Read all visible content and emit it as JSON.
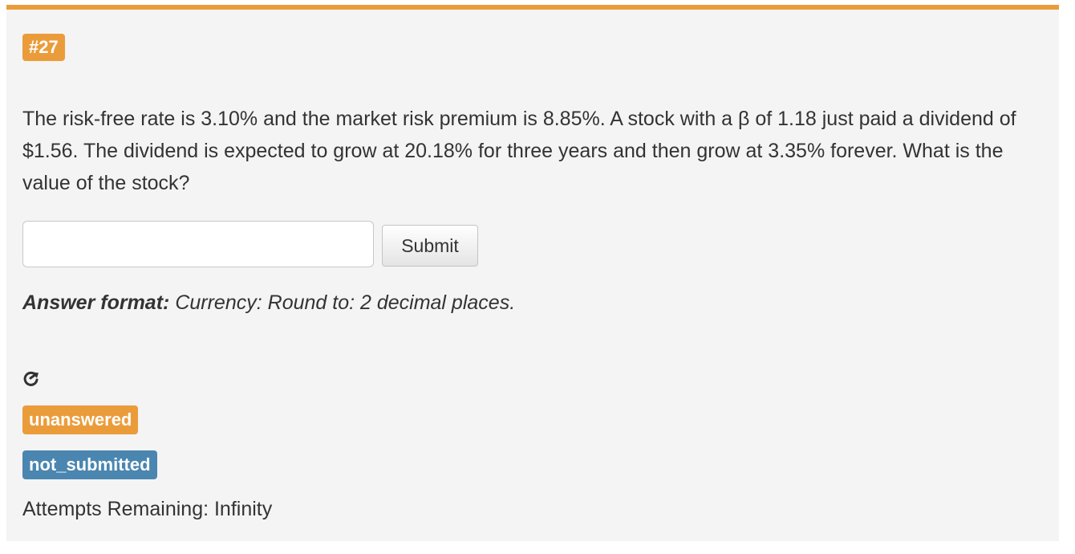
{
  "question": {
    "number": "#27",
    "text": "The risk-free rate is 3.10% and the market risk premium is 8.85%. A stock with a β of 1.18 just paid a dividend of $1.56. The dividend is expected to grow at 20.18% for three years and then grow at 3.35% forever. What is the value of the stock?"
  },
  "answer": {
    "value": "",
    "placeholder": ""
  },
  "submit_label": "Submit",
  "format": {
    "label": "Answer format:",
    "text": "Currency: Round to: 2 decimal places."
  },
  "icons": {
    "share": "share-icon"
  },
  "status": {
    "answer_state": "unanswered",
    "submit_state": "not_submitted",
    "attempts": "Attempts Remaining: Infinity"
  },
  "colors": {
    "accent": "#eb9c3a",
    "info": "#4a86b0",
    "card_background": "#f4f4f4"
  }
}
